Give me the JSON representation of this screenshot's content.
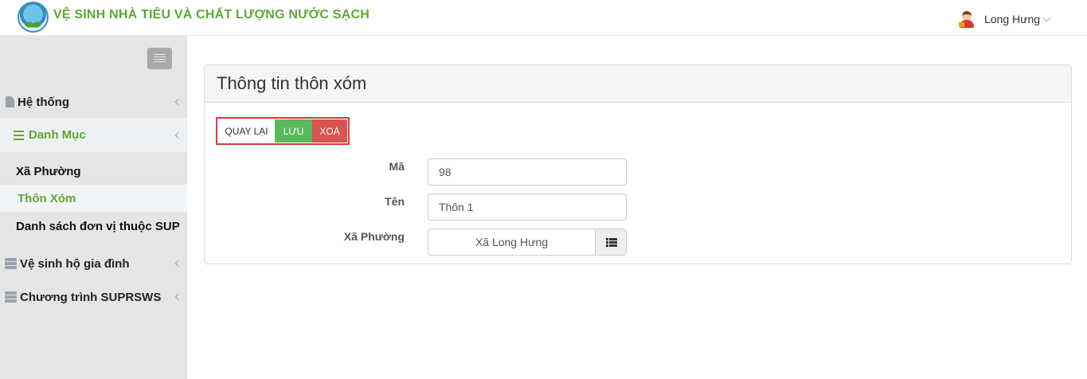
{
  "header": {
    "app_title": "VỆ SINH NHÀ TIÊU VÀ CHẤT LƯỢNG NƯỚC SẠCH",
    "user_name": "Long Hưng"
  },
  "sidebar": {
    "items": [
      {
        "label": "Hệ thống",
        "icon": "document-icon"
      },
      {
        "label": "Danh Mục",
        "icon": "list-bars-icon",
        "active": true
      },
      {
        "label": "Vệ sinh hộ gia đình",
        "icon": "server-icon"
      },
      {
        "label": "Chương trình SUPRSWS",
        "icon": "server-icon"
      }
    ],
    "sub_items": [
      {
        "label": "Xã Phường"
      },
      {
        "label": "Thôn Xóm",
        "active": true
      },
      {
        "label": "Danh sách đơn vị thuộc SUP"
      }
    ]
  },
  "panel": {
    "title": "Thông tin thôn xóm",
    "buttons": {
      "back": "QUAY LẠI",
      "save": "LƯU",
      "delete": "XOÁ"
    },
    "fields": {
      "code": {
        "label": "Mã",
        "value": "98"
      },
      "name": {
        "label": "Tên",
        "value": "Thôn 1"
      },
      "ward": {
        "label": "Xã Phường",
        "value": "Xã Long Hưng"
      }
    }
  },
  "colors": {
    "brand_green": "#5ea833",
    "save_green": "#5cb85c",
    "delete_red": "#d9534f",
    "highlight_red": "#e0383e"
  }
}
